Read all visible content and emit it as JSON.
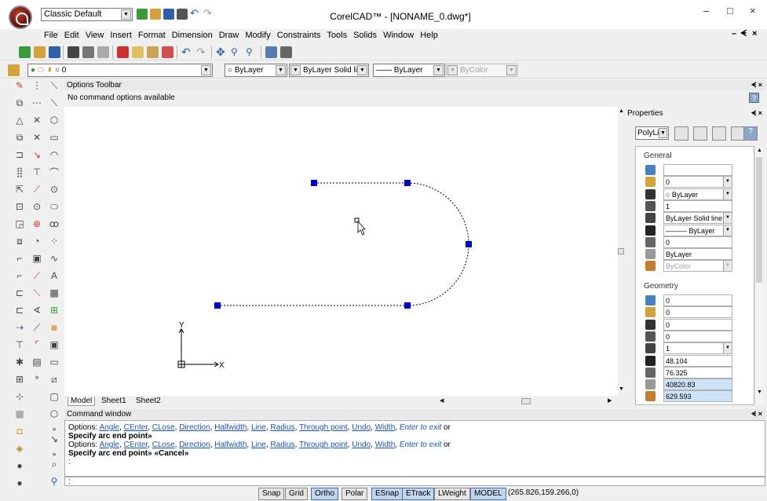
{
  "titlebar": {
    "workspace": "Classic Default",
    "title": "CorelCAD™ - [NONAME_0.dwg*]",
    "minimize": "–",
    "maximize": "□",
    "close": "×"
  },
  "menubar": {
    "items": [
      "File",
      "Edit",
      "View",
      "Insert",
      "Format",
      "Dimension",
      "Draw",
      "Modify",
      "Constraints",
      "Tools",
      "Solids",
      "Window",
      "Help"
    ],
    "doc_controls": "– ฮ ×"
  },
  "layer_toolbar": {
    "layer": "0",
    "color": "ByLayer",
    "linestyle": "ByLayer",
    "linestyle_name": "Solid line",
    "lineweight": "ByLayer",
    "transparency": "ByColor"
  },
  "options_toolbar": {
    "title": "Options Toolbar",
    "message": "No command options available"
  },
  "sheet_tabs": [
    "Model",
    "Sheet1",
    "Sheet2"
  ],
  "axes": {
    "x": "X",
    "y": "Y"
  },
  "properties": {
    "title": "Properties",
    "entity_type": "PolyLine",
    "groups": {
      "general": "General",
      "geometry": "Geometry"
    },
    "general_rows": [
      {
        "icon": "color-wheel-icon",
        "value": "",
        "dropdown": false
      },
      {
        "icon": "layer-icon",
        "value": "0",
        "dropdown": true
      },
      {
        "icon": "color-icon",
        "value": "○ ByLayer",
        "dropdown": true
      },
      {
        "icon": "linescale-icon",
        "value": "1",
        "dropdown": false
      },
      {
        "icon": "linestyle-icon",
        "value": "ByLayer     Solid line",
        "dropdown": true
      },
      {
        "icon": "lineweight-icon",
        "value": "——— ByLayer",
        "dropdown": true
      },
      {
        "icon": "thickness-icon",
        "value": "0",
        "dropdown": false
      },
      {
        "icon": "transparency-icon",
        "value": "ByLayer",
        "dropdown": false
      },
      {
        "icon": "material-icon",
        "value": "ByColor",
        "dropdown": true,
        "disabled": true
      }
    ],
    "geometry_rows": [
      {
        "icon": "vertex-icon",
        "value": "0",
        "dropdown": false
      },
      {
        "icon": "segment-start-width-icon",
        "value": "0",
        "dropdown": false
      },
      {
        "icon": "segment-end-width-icon",
        "value": "0",
        "dropdown": false
      },
      {
        "icon": "global-width-icon",
        "value": "0",
        "dropdown": false
      },
      {
        "icon": "elevation-icon",
        "value": "1",
        "dropdown": true
      },
      {
        "icon": "vertex-x-icon",
        "value": "48.104",
        "dropdown": false
      },
      {
        "icon": "vertex-y-icon",
        "value": "76.325",
        "dropdown": false
      },
      {
        "icon": "area-icon",
        "value": "40820.83",
        "dropdown": false,
        "highlight": true
      },
      {
        "icon": "length-icon",
        "value": "629.593",
        "dropdown": false,
        "highlight": true
      }
    ]
  },
  "command_window": {
    "title": "Command window",
    "options_prefix": "Options: ",
    "options": [
      "Angle",
      "CEnter",
      "CLose",
      "Direction",
      "Halfwidth",
      "Line",
      "Radius",
      "Through point",
      "Undo",
      "Width"
    ],
    "enter_exit": "Enter to exit",
    "or": " or",
    "prompt1": "Specify arc end point»",
    "prompt2": "Specify arc end point» «Cancel»",
    "input_prompt": ":"
  },
  "statusbar": {
    "buttons": [
      {
        "label": "Snap",
        "on": false
      },
      {
        "label": "Grid",
        "on": false
      },
      {
        "label": "Ortho",
        "on": true
      },
      {
        "label": "Polar",
        "on": false
      },
      {
        "label": "ESnap",
        "on": true
      },
      {
        "label": "ETrack",
        "on": true
      },
      {
        "label": "LWeight",
        "on": false
      },
      {
        "label": "MODEL",
        "on": true
      }
    ],
    "coordinates": "(265.826,159.266,0)"
  },
  "colors": {
    "grip": "#0000cc",
    "accent": "#bfd4ee"
  }
}
